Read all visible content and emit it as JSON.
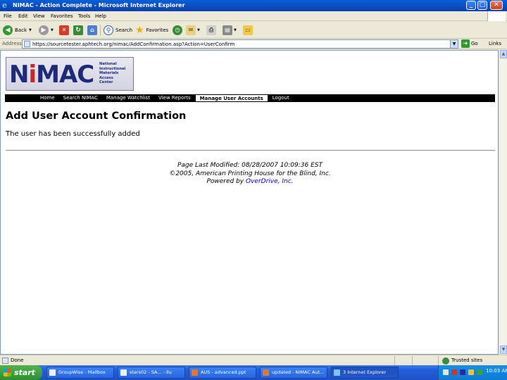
{
  "window": {
    "title": "NIMAC - Action Complete - Microsoft Internet Explorer"
  },
  "menu": [
    "File",
    "Edit",
    "View",
    "Favorites",
    "Tools",
    "Help"
  ],
  "toolbar": {
    "back": "Back",
    "search": "Search",
    "favorites": "Favorites"
  },
  "address": {
    "label": "Address",
    "url": "https://sourcetester.aphtech.org/nimac/AddConfirmation.asp?Action=UserConfirm",
    "go": "Go",
    "links": "Links"
  },
  "logo": {
    "text": "NiMAC",
    "lines": [
      "National",
      "Instructional",
      "Materials",
      "Access",
      "Center"
    ]
  },
  "nav": {
    "items": [
      "Home",
      "Search NIMAC",
      "Manage Watchlist",
      "View Reports",
      "Manage User Accounts",
      "Logout"
    ],
    "active_index": 4
  },
  "page": {
    "title": "Add User Account Confirmation",
    "message": "The user has been successfully added"
  },
  "footer": {
    "modified": "Page Last Modified: 08/28/2007 10:09:36 EST",
    "copyright": "©2005, American Printing House for the Blind, Inc.",
    "powered_prefix": "Powered by ",
    "powered_link": "OverDrive, Inc."
  },
  "status": {
    "text": "Done",
    "zone": "Trusted sites"
  },
  "taskbar": {
    "start": "start",
    "tasks": [
      "GroupWise - Mailbox",
      "stars02 - SA... - ilu",
      "AUS - advanced.ppt",
      "updated - NIMAC Aut...",
      "3 Internet Explorer"
    ],
    "clock": "10:03 AM"
  },
  "colors": {
    "titlebar": "#0a4cc0",
    "nav_bg": "#000000",
    "link": "#0000cc",
    "logo_red": "#c62828",
    "logo_blue": "#1d2a7a"
  }
}
